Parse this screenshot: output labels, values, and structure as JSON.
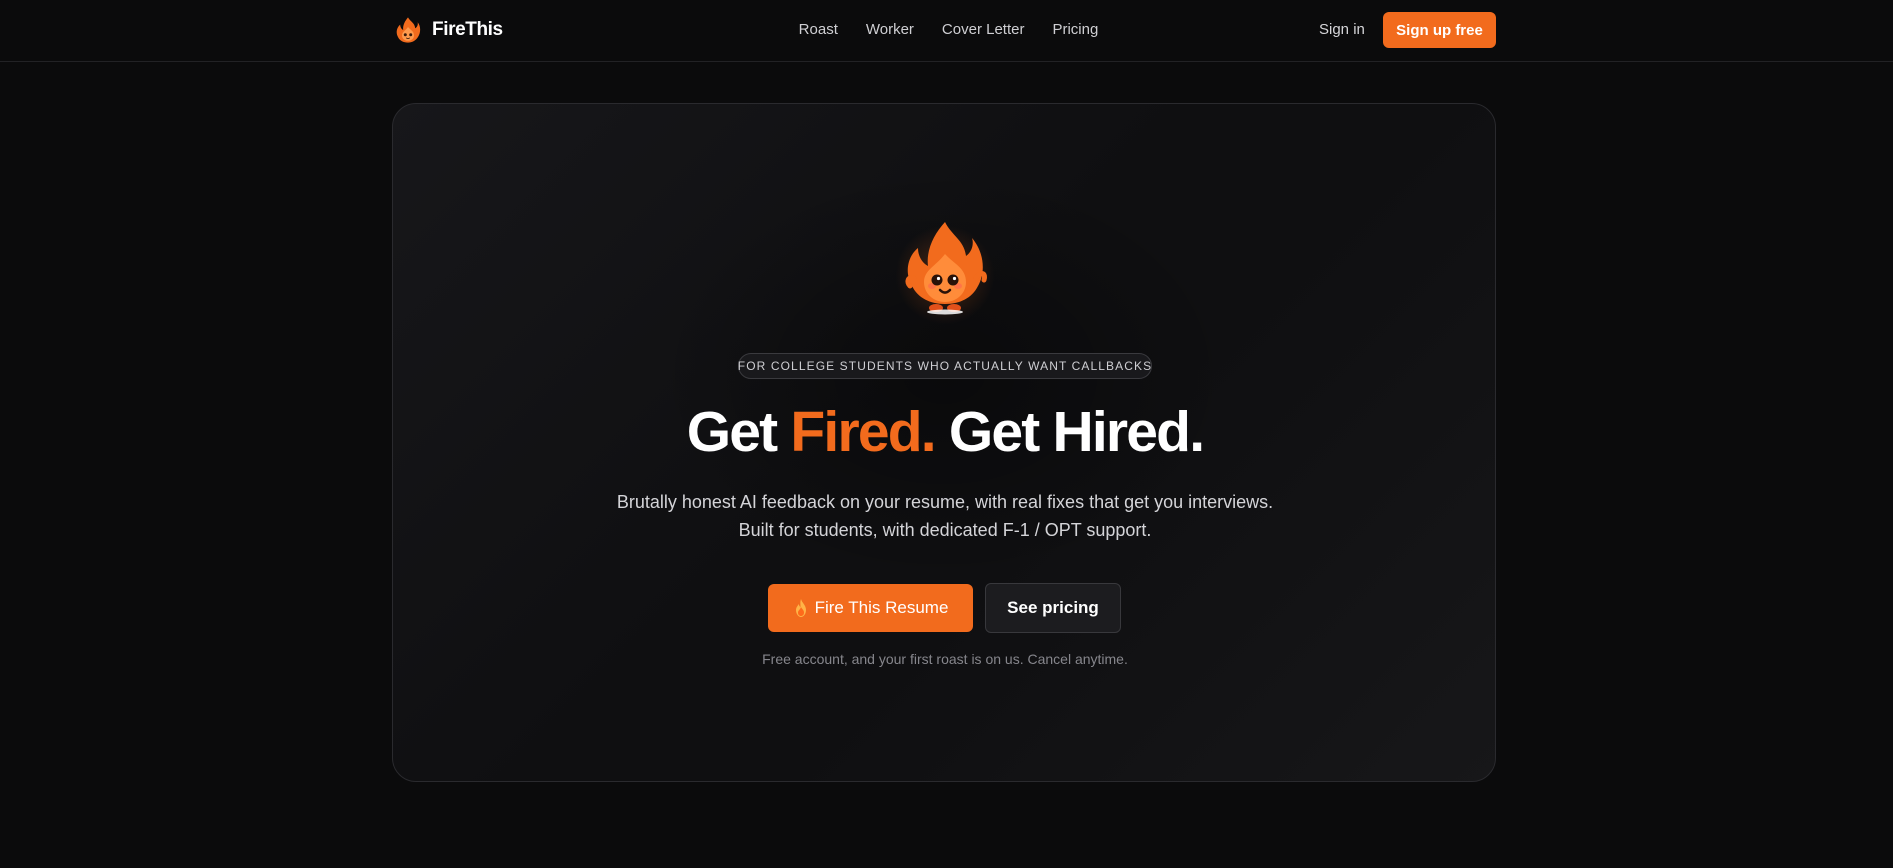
{
  "brand": {
    "name": "FireThis",
    "logo_icon": "flame-mascot-icon"
  },
  "nav": {
    "links": [
      "Roast",
      "Worker",
      "Cover Letter",
      "Pricing"
    ],
    "sign_in": "Sign in",
    "sign_up": "Sign up free"
  },
  "hero": {
    "mascot_icon": "flame-mascot-icon",
    "badge": "FOR COLLEGE STUDENTS WHO ACTUALLY WANT CALLBACKS",
    "headline_part1": "Get ",
    "headline_accent": "Fired.",
    "headline_part2": " Get Hired.",
    "subtitle_line1": "Brutally honest AI feedback on your resume, with real fixes that get you interviews.",
    "subtitle_line2": "Built for students, with dedicated F-1 / OPT support.",
    "primary_cta": "Fire This Resume",
    "primary_cta_icon": "fire-icon",
    "secondary_cta": "See pricing",
    "fine_print": "Free account, and your first roast is on us. Cancel anytime."
  },
  "colors": {
    "accent": "#f26b1d",
    "background": "#0b0b0c",
    "card_border": "#2a2a2e"
  }
}
